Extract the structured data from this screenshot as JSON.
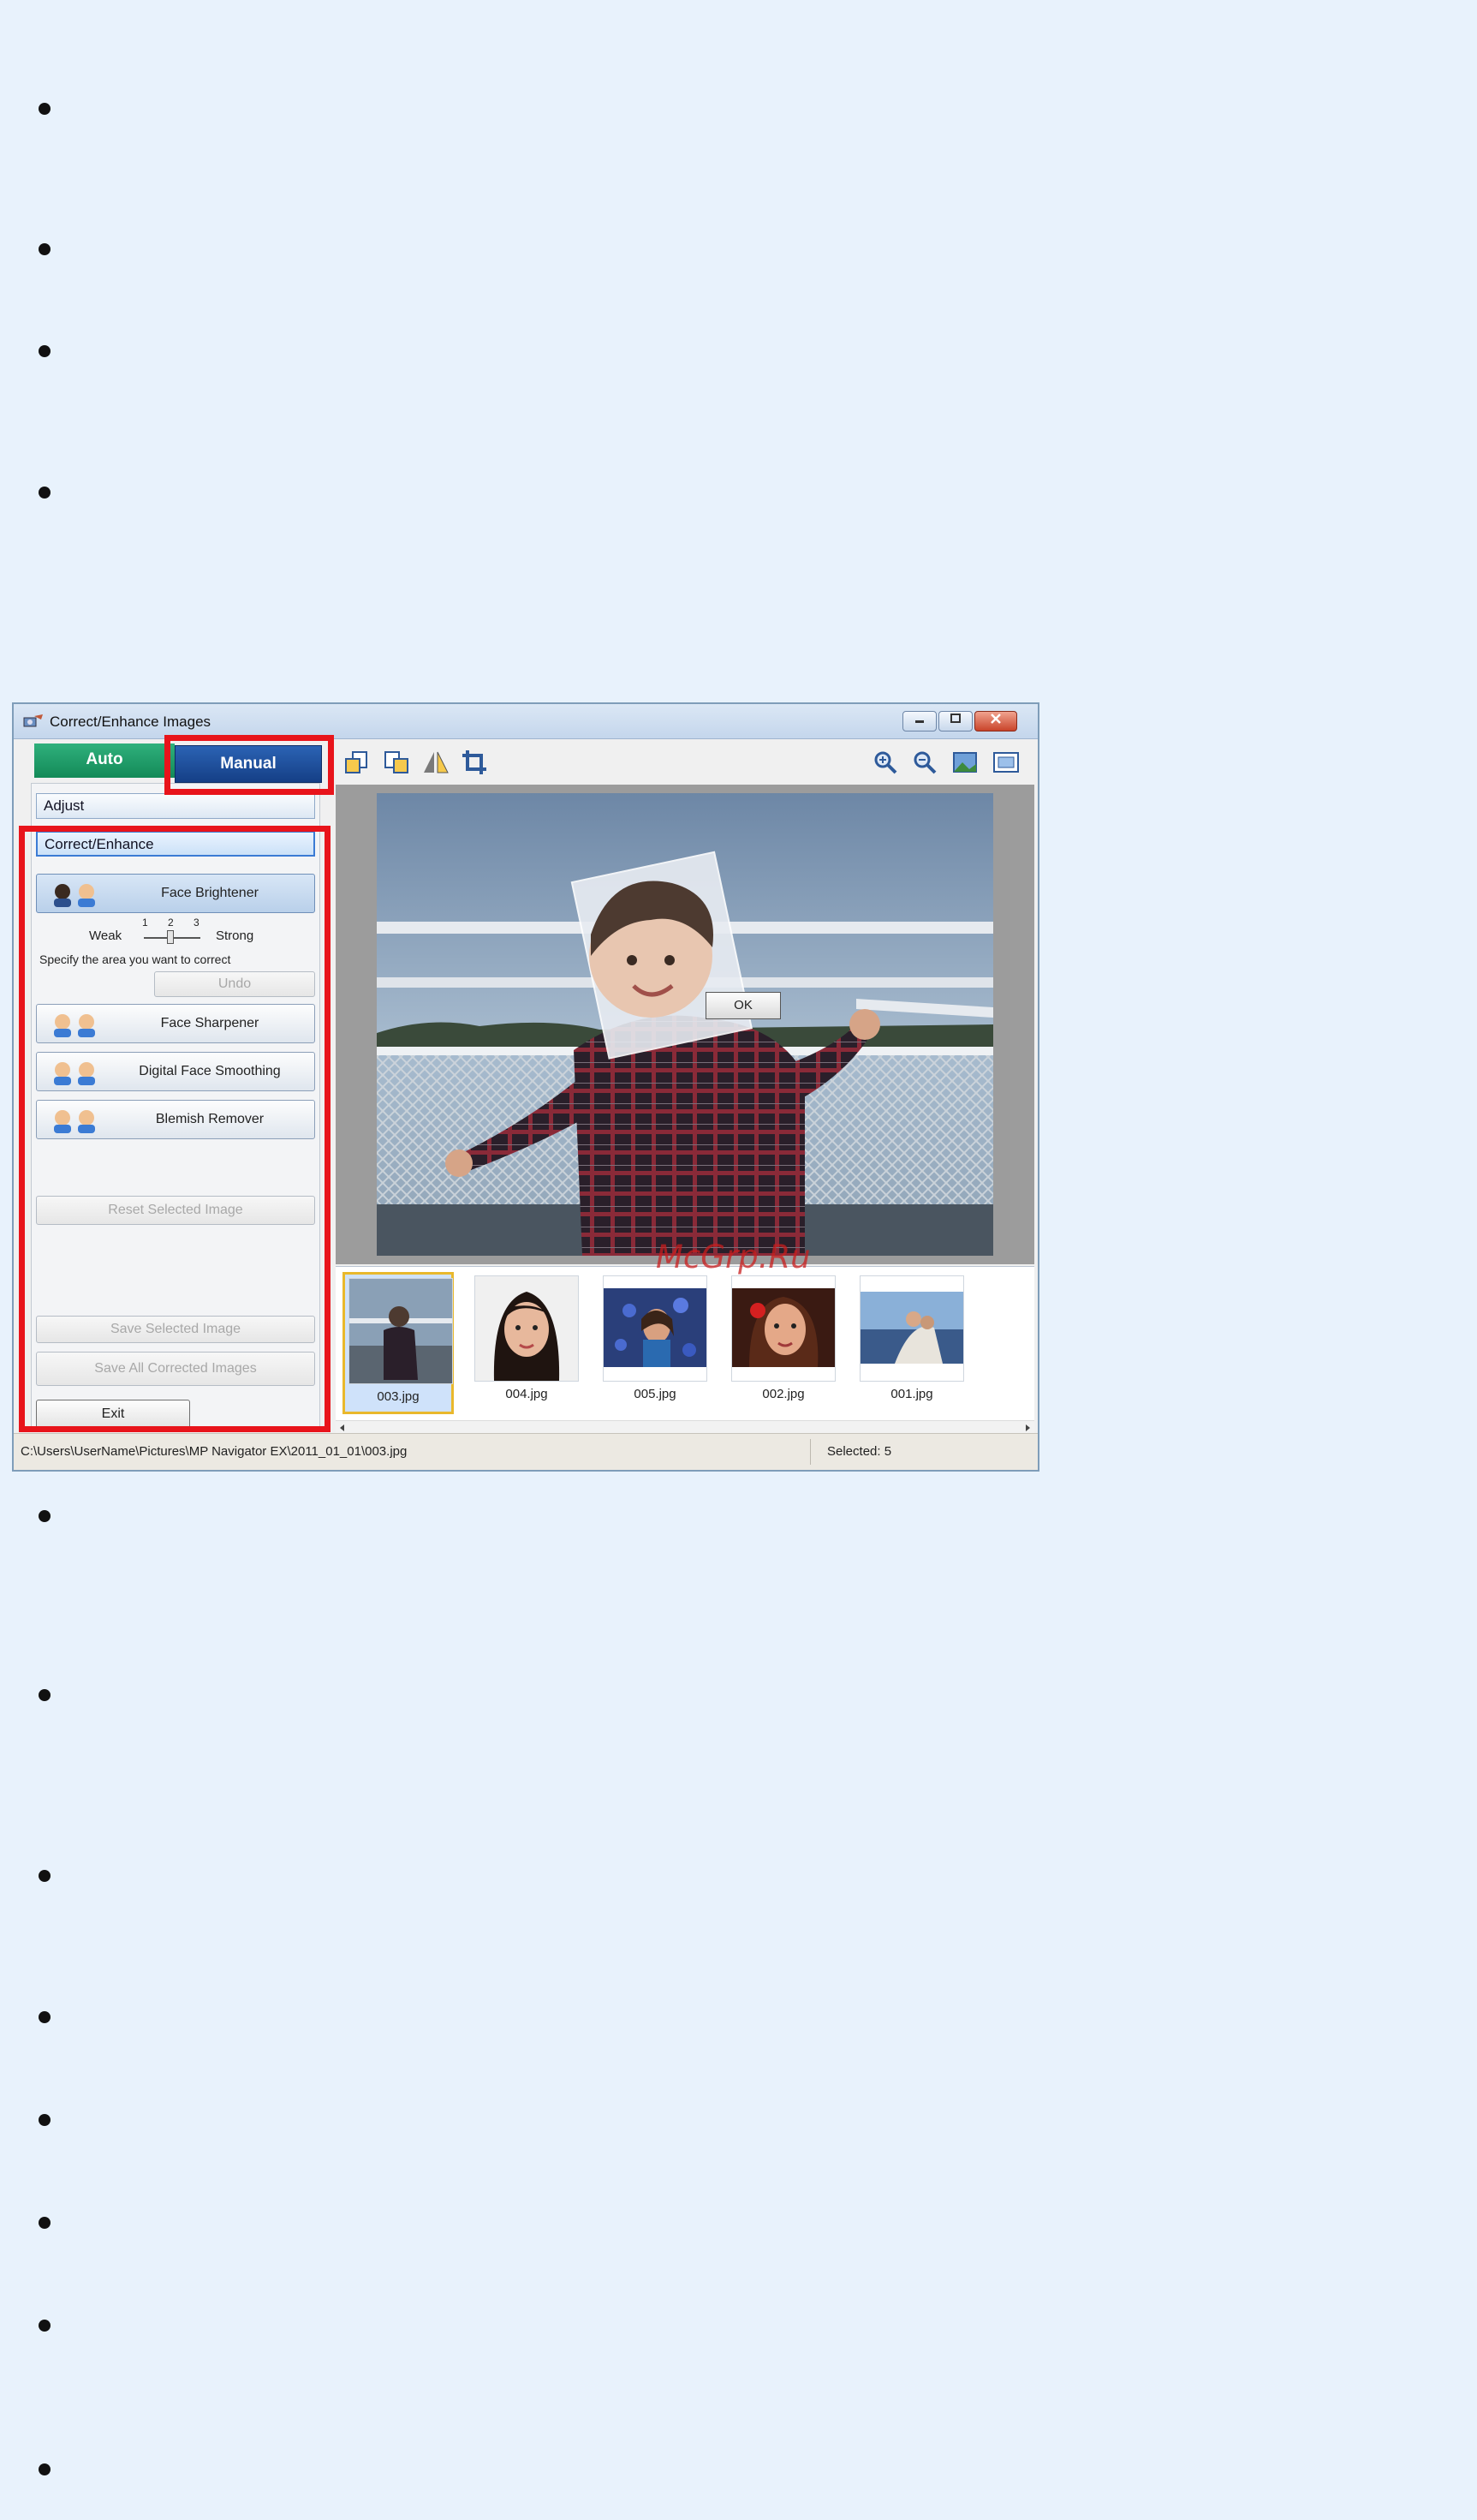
{
  "window": {
    "title": "Correct/Enhance Images",
    "controls": [
      "minimize",
      "maximize",
      "close"
    ]
  },
  "mode_tabs": {
    "auto": "Auto",
    "manual": "Manual"
  },
  "sections": {
    "adjust": "Adjust",
    "correct_enhance": "Correct/Enhance"
  },
  "tools": {
    "face_brightener": "Face Brightener",
    "level": {
      "weak": "Weak",
      "strong": "Strong",
      "ticks": [
        "1",
        "2",
        "3"
      ],
      "value": 2
    },
    "hint": "Specify the area you want to correct",
    "undo": "Undo",
    "face_sharpener": "Face Sharpener",
    "digital_face_smoothing": "Digital Face Smoothing",
    "blemish_remover": "Blemish Remover",
    "reset_selected_image": "Reset Selected Image",
    "save_selected_image": "Save Selected Image",
    "save_all_corrected_images": "Save All Corrected Images",
    "exit": "Exit"
  },
  "toolbar_icons": [
    "rotate-left-icon",
    "rotate-right-icon",
    "flip-icon",
    "crop-icon",
    "zoom-in-icon",
    "zoom-out-icon",
    "full-image-icon",
    "actual-size-icon"
  ],
  "preview": {
    "ok_button": "OK"
  },
  "thumbnails": [
    {
      "name": "003.jpg",
      "selected": true
    },
    {
      "name": "004.jpg",
      "selected": false
    },
    {
      "name": "005.jpg",
      "selected": false
    },
    {
      "name": "002.jpg",
      "selected": false
    },
    {
      "name": "001.jpg",
      "selected": false
    }
  ],
  "statusbar": {
    "path": "C:\\Users\\UserName\\Pictures\\MP Navigator EX\\2011_01_01\\003.jpg",
    "selected": "Selected: 5"
  },
  "watermark": "McGrp.Ru",
  "colors": {
    "highlight": "#e8141b",
    "auto_tab": "#1a9a66",
    "manual_tab": "#1f4f9e",
    "page_bg": "#e8f2fc"
  }
}
